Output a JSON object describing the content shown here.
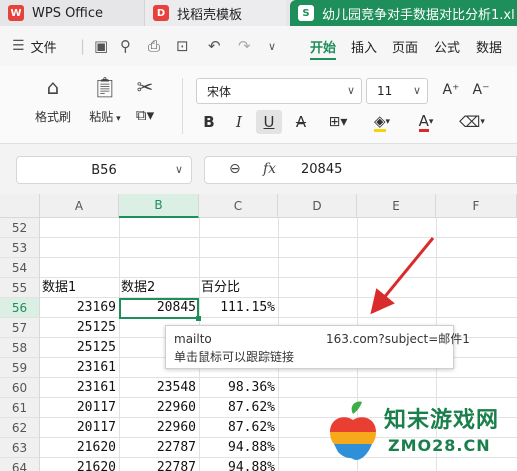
{
  "tabs": [
    {
      "label": "WPS Office",
      "icon": "wps-logo-icon"
    },
    {
      "label": "找稻壳模板",
      "icon": "docer-logo-icon"
    },
    {
      "label": "幼儿园竞争对手数据对比分析1.xl",
      "icon": "spreadsheet-s-icon",
      "icon_text": "S"
    }
  ],
  "menu": {
    "hamburger_icon": "menu-icon",
    "file_label": "文件",
    "quick_icons": [
      "save-icon",
      "link-icon",
      "print-icon",
      "print-preview-icon",
      "undo-icon",
      "redo-icon",
      "more-dropdown-icon"
    ],
    "ribbon_tabs": [
      "开始",
      "插入",
      "页面",
      "公式",
      "数据"
    ],
    "active_tab": "开始"
  },
  "ribbon": {
    "format_painter_label": "格式刷",
    "paste_label": "粘贴",
    "font_name": "宋体",
    "font_size": "11",
    "increase_font_label": "A⁺",
    "decrease_font_label": "A⁻",
    "bold_label": "B",
    "italic_label": "I",
    "underline_label": "U",
    "strike_label": "A"
  },
  "formula_bar": {
    "cell_ref": "B56",
    "fx_label": "fx",
    "value": "20845"
  },
  "sheet": {
    "columns": [
      "A",
      "B",
      "C",
      "D",
      "E",
      "F"
    ],
    "selected_column": "B",
    "selected_row": "56",
    "rows": [
      {
        "num": "52",
        "a": "",
        "b": "",
        "c": ""
      },
      {
        "num": "53",
        "a": "",
        "b": "",
        "c": ""
      },
      {
        "num": "54",
        "a": "",
        "b": "",
        "c": ""
      },
      {
        "num": "55",
        "a": "数据1",
        "b": "数据2",
        "c": "百分比"
      },
      {
        "num": "56",
        "a": "23169",
        "b": "20845",
        "c": "111.15%"
      },
      {
        "num": "57",
        "a": "25125",
        "b": "",
        "c": ""
      },
      {
        "num": "58",
        "a": "25125",
        "b": "",
        "c": ""
      },
      {
        "num": "59",
        "a": "23161",
        "b": "",
        "c": ""
      },
      {
        "num": "60",
        "a": "23161",
        "b": "23548",
        "c": "98.36%"
      },
      {
        "num": "61",
        "a": "20117",
        "b": "22960",
        "c": "87.62%"
      },
      {
        "num": "62",
        "a": "20117",
        "b": "22960",
        "c": "87.62%"
      },
      {
        "num": "63",
        "a": "21620",
        "b": "22787",
        "c": "94.88%"
      },
      {
        "num": "64",
        "a": "21620",
        "b": "22787",
        "c": "94.88%"
      }
    ]
  },
  "hyperlink_tooltip": {
    "link_start": "mailto",
    "link_end": "163.com?subject=邮件1",
    "hint": "单击鼠标可以跟踪链接"
  },
  "colors": {
    "accent": "#1e8e5a",
    "arrow": "#d92b2b"
  },
  "watermark": {
    "text": "知末游戏网",
    "domain": "ZMO28.CN"
  }
}
